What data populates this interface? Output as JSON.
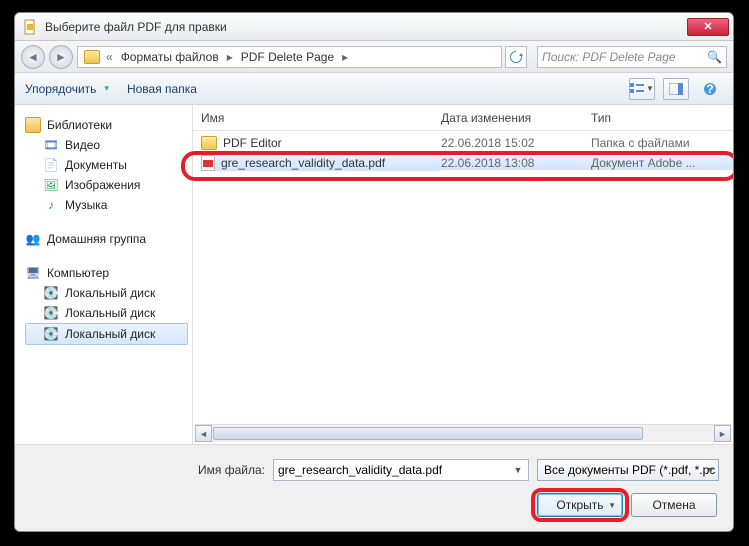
{
  "title": "Выберите файл PDF для правки",
  "breadcrumb": {
    "seg1": "Форматы файлов",
    "seg2": "PDF Delete Page"
  },
  "search": {
    "placeholder": "Поиск: PDF Delete Page"
  },
  "toolbar": {
    "organize": "Упорядочить",
    "newfolder": "Новая папка"
  },
  "sidebar": {
    "libraries": "Библиотеки",
    "video": "Видео",
    "documents": "Документы",
    "images": "Изображения",
    "music": "Музыка",
    "homegroup": "Домашняя группа",
    "computer": "Компьютер",
    "disk1": "Локальный диск",
    "disk2": "Локальный диск"
  },
  "columns": {
    "name": "Имя",
    "date": "Дата изменения",
    "type": "Тип"
  },
  "files": [
    {
      "name": "PDF Editor",
      "date": "22.06.2018 15:02",
      "type": "Папка с файлами",
      "icon": "folder"
    },
    {
      "name": "gre_research_validity_data.pdf",
      "date": "22.06.2018 13:08",
      "type": "Документ Adobe ...",
      "icon": "pdf",
      "selected": true
    }
  ],
  "footer": {
    "filename_label": "Имя файла:",
    "filename_value": "gre_research_validity_data.pdf",
    "filter": "Все документы PDF (*.pdf, *.pс",
    "open": "Открыть",
    "cancel": "Отмена"
  }
}
